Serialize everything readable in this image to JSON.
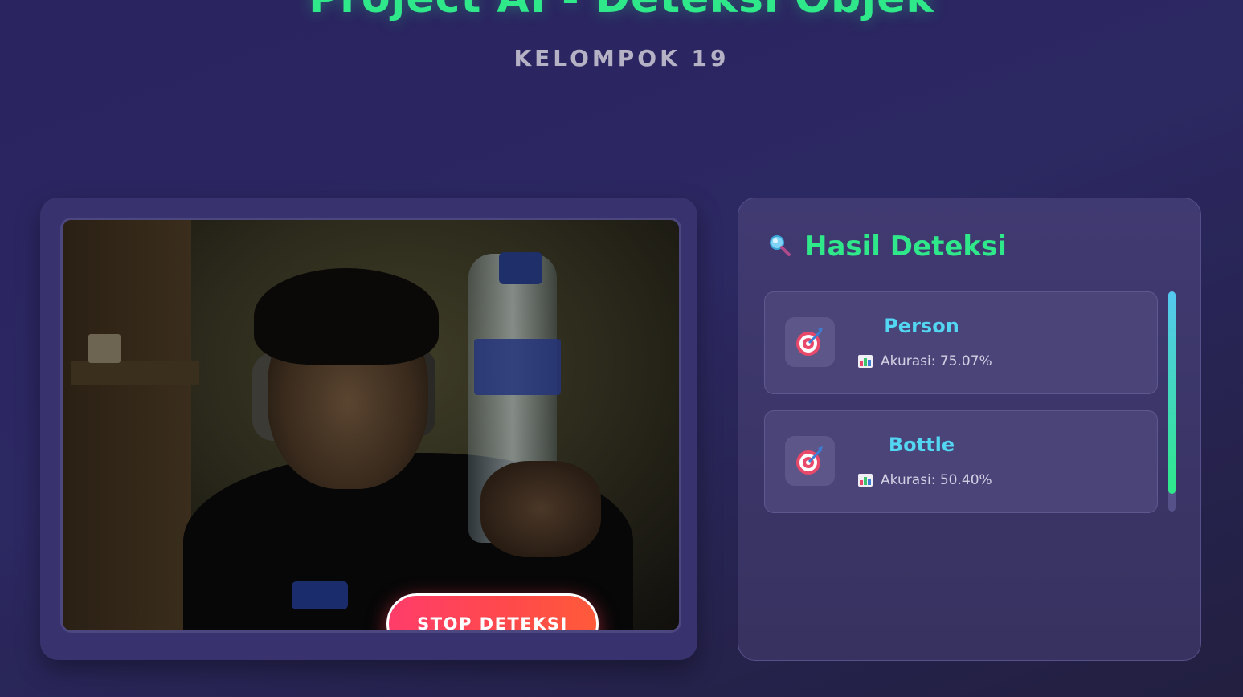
{
  "header": {
    "title": "Project AI - Deteksi Objek",
    "subtitle": "KELOMPOK 19"
  },
  "camera": {
    "stop_button_label": "STOP DETEKSI"
  },
  "results": {
    "title": "Hasil Deteksi",
    "title_icon": "magnifier-icon",
    "items": [
      {
        "name": "Person",
        "accuracy_text": "Akurasi: 75.07%",
        "icon": "target-icon",
        "accuracy_icon": "bar-chart-icon"
      },
      {
        "name": "Bottle",
        "accuracy_text": "Akurasi: 50.40%",
        "icon": "target-icon",
        "accuracy_icon": "bar-chart-icon"
      }
    ]
  },
  "colors": {
    "accent_green": "#2ee88a",
    "accent_cyan": "#52d6f2",
    "stop_red": "#ff4a4a",
    "background": "#2a2460"
  }
}
